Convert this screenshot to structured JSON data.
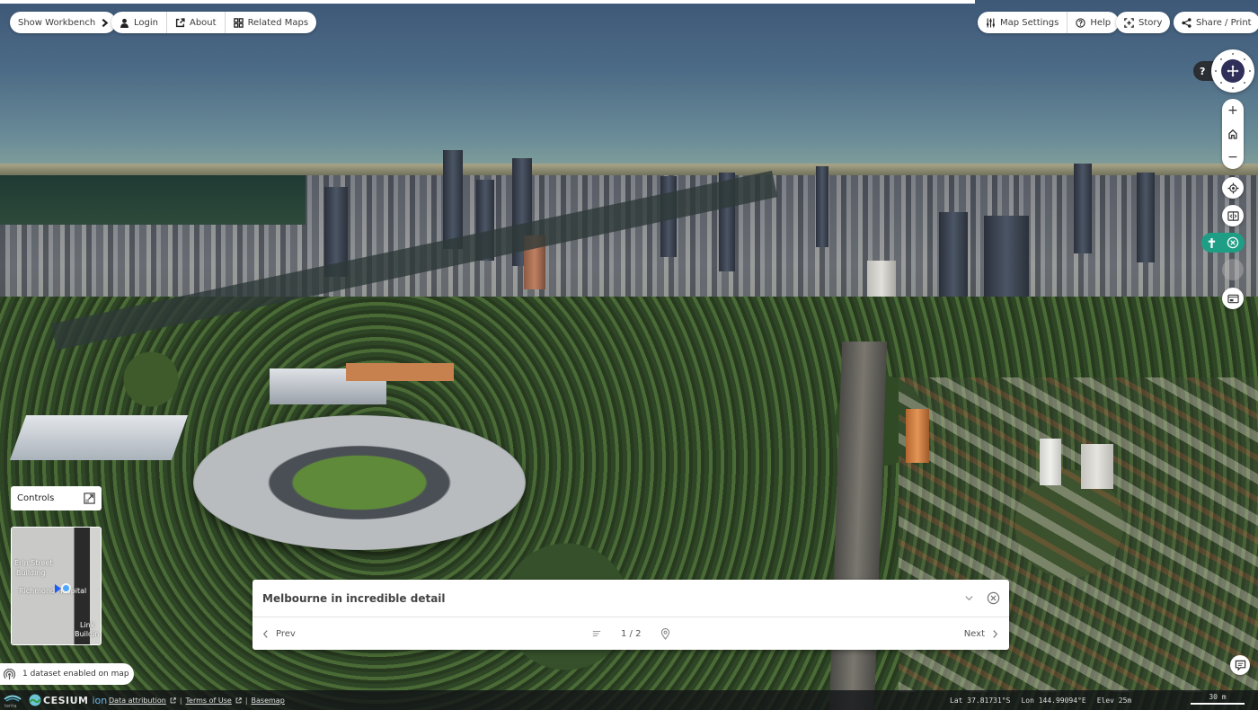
{
  "toolbar_left": {
    "workbench": {
      "label": "Show Workbench",
      "icon": "chevron-right-icon"
    },
    "items": [
      {
        "label": "Login",
        "icon": "user-icon"
      },
      {
        "label": "About",
        "icon": "external-link-icon"
      },
      {
        "label": "Related Maps",
        "icon": "grid-icon"
      }
    ]
  },
  "toolbar_right": {
    "settings_group": [
      {
        "label": "Map Settings",
        "icon": "sliders-icon"
      },
      {
        "label": "Help",
        "icon": "help-circle-icon"
      }
    ],
    "story": {
      "label": "Story",
      "icon": "story-frame-icon"
    },
    "share": {
      "label": "Share / Print",
      "icon": "share-icon"
    }
  },
  "nav": {
    "help_label": "?",
    "zoom_in": "+",
    "zoom_out": "−",
    "compass_icon": "move-icon",
    "home_icon": "home-icon",
    "locate_icon": "locate-icon",
    "split_icon": "split-screen-icon",
    "pedestrian_icon": "pedestrian-icon",
    "close_icon": "close-circle-icon",
    "measure_icon": "measure-icon",
    "accent_color": "#1f9e86"
  },
  "controls": {
    "label": "Controls",
    "expand_icon": "expand-icon",
    "minimap_labels": [
      "Erin Street",
      "Building",
      "Richmond Hospital",
      "Link",
      "Buildin"
    ]
  },
  "dataset_status": {
    "label": "1 dataset enabled on map",
    "icon": "broadcast-icon"
  },
  "story": {
    "title": "Melbourne in incredible detail",
    "prev_label": "Prev",
    "next_label": "Next",
    "page_indicator": "1 / 2",
    "current_page": 1,
    "total_pages": 2
  },
  "footer": {
    "terria_logo": "terria",
    "cesium_label": "CESIUM",
    "ion_label": "ion",
    "links": [
      "Data attribution",
      "Terms of Use",
      "Basemap"
    ],
    "lat": "Lat  37.81731°S",
    "lon": "Lon  144.99094°E",
    "elev": "Elev  25m",
    "scale_label": "30 m"
  }
}
